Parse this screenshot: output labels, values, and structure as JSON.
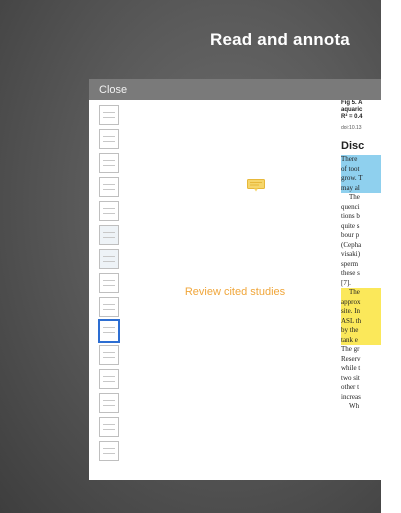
{
  "headline": "Read and annota",
  "viewer": {
    "close_label": "Close",
    "thumbnails": [
      {
        "label": ""
      },
      {
        "label": ""
      },
      {
        "label": ""
      },
      {
        "label": ""
      },
      {
        "label": ""
      },
      {
        "label": ""
      },
      {
        "label": ""
      },
      {
        "label": ""
      },
      {
        "label": ""
      },
      {
        "label": ""
      },
      {
        "label": ""
      },
      {
        "label": ""
      },
      {
        "label": ""
      },
      {
        "label": ""
      },
      {
        "label": ""
      }
    ],
    "selected_thumbnail": 9,
    "annotation_text": "Review cited studies",
    "note_icon": "speech-bubble-note-icon"
  },
  "document": {
    "caption_lines": [
      "Fig 5. A",
      "aquaric",
      "R² = 0.4"
    ],
    "doi": "doi:10.13",
    "heading": "Disc",
    "lines": [
      {
        "text": "There",
        "style": "blue"
      },
      {
        "text": "of toot",
        "style": "blue"
      },
      {
        "text": "grow. T",
        "style": "blue"
      },
      {
        "text": "may al",
        "style": "blue"
      },
      {
        "text": "The",
        "style": "indent"
      },
      {
        "text": "quenci",
        "style": ""
      },
      {
        "text": "tions b",
        "style": ""
      },
      {
        "text": "quite s",
        "style": ""
      },
      {
        "text": "bour p",
        "style": ""
      },
      {
        "text": "(Cepha",
        "style": ""
      },
      {
        "text": "visaki)",
        "style": ""
      },
      {
        "text": "sperm",
        "style": ""
      },
      {
        "text": "these s",
        "style": ""
      },
      {
        "text": "[7].",
        "style": ""
      },
      {
        "text": "The",
        "style": "yellow-indent"
      },
      {
        "text": "approx",
        "style": "yellow"
      },
      {
        "text": "site. In",
        "style": "yellow"
      },
      {
        "text": "ASL th",
        "style": "yellow"
      },
      {
        "text": "by the",
        "style": "yellow"
      },
      {
        "text": "tank e",
        "style": "yellow"
      },
      {
        "text": "The gr",
        "style": ""
      },
      {
        "text": "Reserv",
        "style": ""
      },
      {
        "text": "while t",
        "style": ""
      },
      {
        "text": "two sit",
        "style": ""
      },
      {
        "text": "other t",
        "style": ""
      },
      {
        "text": "increas",
        "style": ""
      },
      {
        "text": "Wh",
        "style": "indent"
      }
    ]
  }
}
